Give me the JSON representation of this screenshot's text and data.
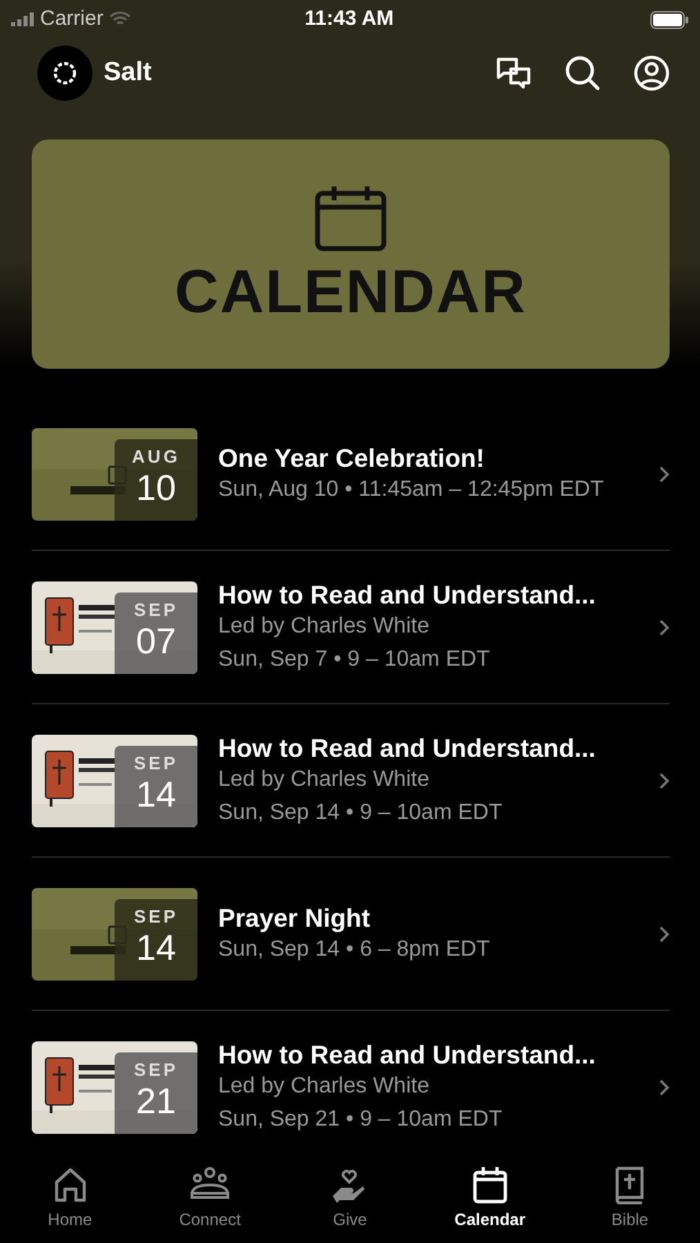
{
  "status_bar": {
    "carrier": "Carrier",
    "time": "11:43 AM"
  },
  "header": {
    "title": "Salt"
  },
  "banner": {
    "title": "CALENDAR"
  },
  "events": [
    {
      "kind": "calendar",
      "month": "AUG",
      "day": "10",
      "title": "One Year Celebration!",
      "lines": [
        "Sun, Aug 10 • 11:45am – 12:45pm EDT"
      ]
    },
    {
      "kind": "bible",
      "month": "SEP",
      "day": "07",
      "title": "How to Read and Understand...",
      "lines": [
        "Led by Charles White",
        "Sun, Sep 7 • 9 – 10am EDT"
      ]
    },
    {
      "kind": "bible",
      "month": "SEP",
      "day": "14",
      "title": "How to Read and Understand...",
      "lines": [
        "Led by Charles White",
        "Sun, Sep 14 • 9 – 10am EDT"
      ]
    },
    {
      "kind": "calendar",
      "month": "SEP",
      "day": "14",
      "title": "Prayer Night",
      "lines": [
        "Sun, Sep 14 • 6 – 8pm EDT"
      ]
    },
    {
      "kind": "bible",
      "month": "SEP",
      "day": "21",
      "title": "How to Read and Understand...",
      "lines": [
        "Led by Charles White",
        "Sun, Sep 21 • 9 – 10am EDT"
      ]
    }
  ],
  "tabs": [
    {
      "label": "Home",
      "selected": false
    },
    {
      "label": "Connect",
      "selected": false
    },
    {
      "label": "Give",
      "selected": false
    },
    {
      "label": "Calendar",
      "selected": true
    },
    {
      "label": "Bible",
      "selected": false
    }
  ]
}
